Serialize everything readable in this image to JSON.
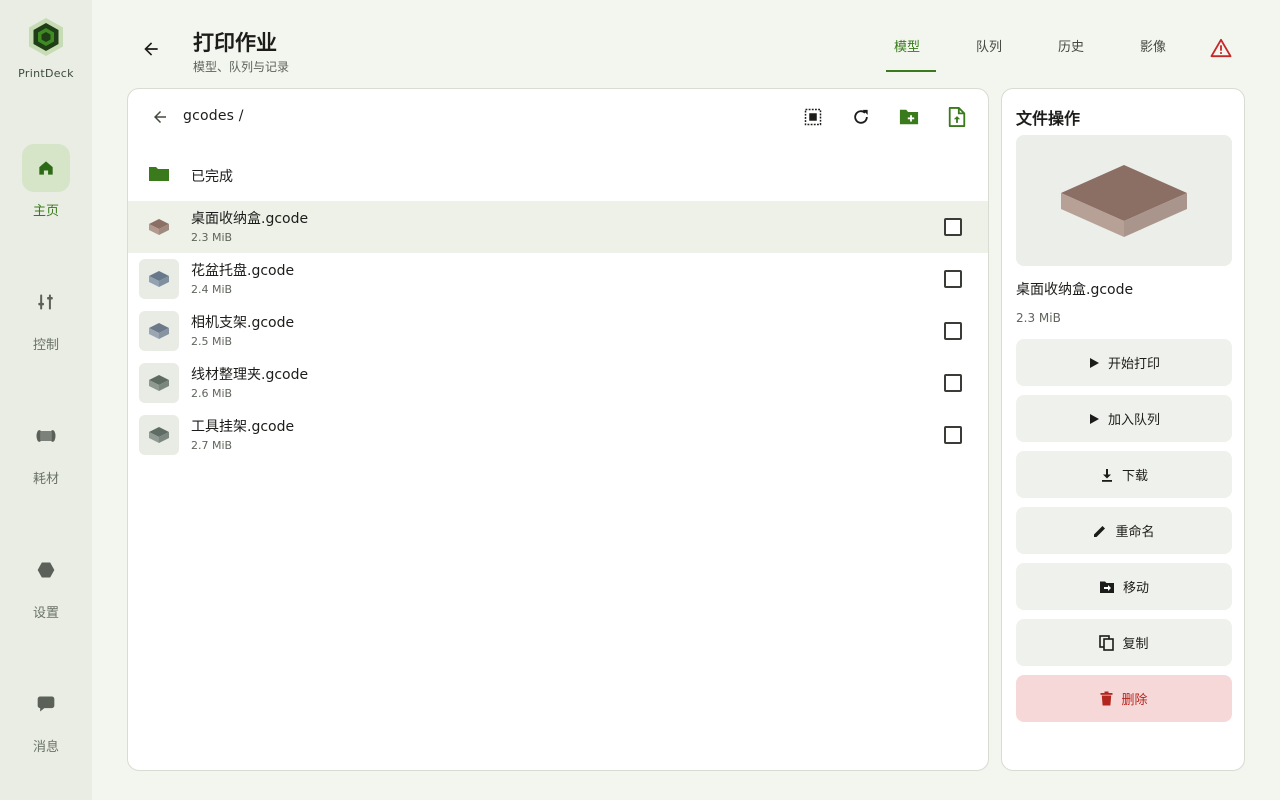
{
  "app": {
    "name": "PrintDeck"
  },
  "nav": [
    {
      "key": "home",
      "label": "主页",
      "icon": "home-icon",
      "active": true
    },
    {
      "key": "control",
      "label": "控制",
      "icon": "sliders-icon",
      "active": false
    },
    {
      "key": "filament",
      "label": "耗材",
      "icon": "spool-icon",
      "active": false
    },
    {
      "key": "settings",
      "label": "设置",
      "icon": "hexagon-icon",
      "active": false
    },
    {
      "key": "messages",
      "label": "消息",
      "icon": "chat-icon",
      "active": false
    }
  ],
  "header": {
    "title": "打印作业",
    "subtitle": "模型、队列与记录",
    "tabs": [
      {
        "label": "模型",
        "active": true
      },
      {
        "label": "队列",
        "active": false
      },
      {
        "label": "历史",
        "active": false
      },
      {
        "label": "影像",
        "active": false
      }
    ]
  },
  "browser": {
    "path": "gcodes /",
    "folders": [
      {
        "name": "已完成"
      }
    ],
    "files": [
      {
        "name": "桌面收纳盒.gcode",
        "size": "2.3 MiB",
        "selected": true,
        "top": "#8b6e64",
        "side": "#b39a90"
      },
      {
        "name": "花盆托盘.gcode",
        "size": "2.4 MiB",
        "selected": false,
        "top": "#66788a",
        "side": "#93a2b0"
      },
      {
        "name": "相机支架.gcode",
        "size": "2.5 MiB",
        "selected": false,
        "top": "#6a7889",
        "side": "#9aa7b3"
      },
      {
        "name": "线材整理夹.gcode",
        "size": "2.6 MiB",
        "selected": false,
        "top": "#5d6b60",
        "side": "#8e9a90"
      },
      {
        "name": "工具挂架.gcode",
        "size": "2.7 MiB",
        "selected": false,
        "top": "#5f6c64",
        "side": "#8f9b94"
      }
    ]
  },
  "details": {
    "title": "文件操作",
    "selected_name": "桌面收纳盒.gcode",
    "selected_size": "2.3 MiB",
    "actions": [
      {
        "label": "开始打印",
        "icon": "play-icon"
      },
      {
        "label": "加入队列",
        "icon": "play-icon"
      },
      {
        "label": "下载",
        "icon": "download-icon"
      },
      {
        "label": "重命名",
        "icon": "pencil-icon"
      },
      {
        "label": "移动",
        "icon": "folder-move-icon"
      },
      {
        "label": "复制",
        "icon": "copy-icon"
      },
      {
        "label": "删除",
        "icon": "trash-icon",
        "danger": true
      }
    ]
  },
  "colors": {
    "accent": "#3a7a1c",
    "danger": "#b3261e",
    "warning": "#c62828"
  }
}
